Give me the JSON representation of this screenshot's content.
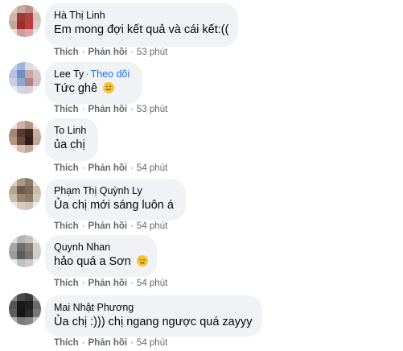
{
  "comments": [
    {
      "name": "Hà Thị Linh",
      "text": "Em mong đợi kết quả và cái kết:((",
      "like": "Thích",
      "reply": "Phản hồi",
      "time": "53 phút",
      "avatar_colors": [
        "#d9c9c2",
        "#c9a9a0",
        "#b8928a",
        "#e4d6d1",
        "#cfb6ac",
        "#a33a3a",
        "#b34141",
        "#d4c3bd",
        "#c4a59c",
        "#9e2e2e",
        "#c23b3b",
        "#d8cbc6",
        "#e6dcd8",
        "#cf9c9c",
        "#d9a9a9",
        "#ece6e3"
      ]
    },
    {
      "name": "Lee Ty",
      "follow": "Theo dõi",
      "text": "Tức ghê",
      "emoji": "slightly-smiling-face-emoji",
      "like": "Thích",
      "reply": "Phản hồi",
      "time": "53 phút",
      "avatar_colors": [
        "#c3d1e6",
        "#9fb6d8",
        "#d6dde9",
        "#e8e3e6",
        "#b1c3df",
        "#6f8fc4",
        "#c9a7a3",
        "#d8c6c6",
        "#c7d0e0",
        "#8ca6cf",
        "#b37f7f",
        "#cfc1c7",
        "#e6e9ef",
        "#cdd6e6",
        "#d9d2d8",
        "#eef0f4"
      ]
    },
    {
      "name": "To Linh",
      "text": "ủa chị",
      "like": "Thích",
      "reply": "Phản hồi",
      "time": "54 phút",
      "avatar_colors": [
        "#e9e1dc",
        "#c9b3a8",
        "#b59686",
        "#ece6e3",
        "#a88474",
        "#5a3a30",
        "#3e2720",
        "#c8ad9f",
        "#b69380",
        "#6d4a3d",
        "#2e1d19",
        "#c3a392",
        "#efe9e6",
        "#d4beb3",
        "#c2a494",
        "#f1ece9"
      ]
    },
    {
      "name": "Phạm Thị Quỳnh Ly",
      "text": "Ủa chị mới sáng luôn á",
      "like": "Thích",
      "reply": "Phản hồi",
      "time": "54 phút",
      "avatar_colors": [
        "#d7d0c4",
        "#a89a84",
        "#8c7c66",
        "#e0dbd3",
        "#b4a58e",
        "#6d5d48",
        "#7a6a55",
        "#c9bda9",
        "#c8bca8",
        "#998770",
        "#8b7a63",
        "#d3c9b8",
        "#ebe8e3",
        "#d6ccbd",
        "#cfc4b3",
        "#eeebe6"
      ]
    },
    {
      "name": "Quynh Nhan",
      "text": "hảo quá a Sơn",
      "emoji": "disappointed-face-emoji",
      "like": "Thích",
      "reply": "Phản hồi",
      "time": "54 phút",
      "avatar_colors": [
        "#dcdcdc",
        "#b4b4b4",
        "#c7c0bc",
        "#e7e7e7",
        "#a6a6a6",
        "#6e6e6e",
        "#8a7f7a",
        "#cfcfcf",
        "#9c9c9c",
        "#5c5c5c",
        "#7d736f",
        "#d0ccca",
        "#e9e9e9",
        "#c1c1c1",
        "#cccccc",
        "#efefef"
      ]
    },
    {
      "name": "Mai Nhật Phương",
      "text": "Ủa chị :))) chị ngang ngược quá zayyy",
      "like": "Thích",
      "reply": "Phản hồi",
      "time": "54 phút",
      "avatar_colors": [
        "#8a8a8a",
        "#4a4a4a",
        "#3a3a3a",
        "#9a9a9a",
        "#555555",
        "#1a1a1a",
        "#202020",
        "#6a6a6a",
        "#5e5e5e",
        "#151515",
        "#2a2a2a",
        "#777777",
        "#b0b0b0",
        "#7a7a7a",
        "#858585",
        "#c2c2c2"
      ]
    }
  ]
}
